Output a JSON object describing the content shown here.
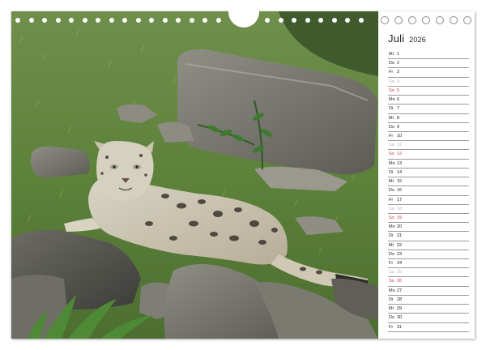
{
  "calendar": {
    "month": "Juli",
    "year": "2026",
    "days": [
      {
        "wd": "Mi",
        "d": "1",
        "kind": "weekday"
      },
      {
        "wd": "Do",
        "d": "2",
        "kind": "weekday"
      },
      {
        "wd": "Fr",
        "d": "3",
        "kind": "weekday"
      },
      {
        "wd": "Sa",
        "d": "4",
        "kind": "saturday"
      },
      {
        "wd": "So",
        "d": "5",
        "kind": "sunday"
      },
      {
        "wd": "Mo",
        "d": "6",
        "kind": "weekday"
      },
      {
        "wd": "Di",
        "d": "7",
        "kind": "weekday"
      },
      {
        "wd": "Mi",
        "d": "8",
        "kind": "weekday"
      },
      {
        "wd": "Do",
        "d": "9",
        "kind": "weekday"
      },
      {
        "wd": "Fr",
        "d": "10",
        "kind": "weekday"
      },
      {
        "wd": "Sa",
        "d": "11",
        "kind": "saturday"
      },
      {
        "wd": "So",
        "d": "12",
        "kind": "sunday"
      },
      {
        "wd": "Mo",
        "d": "13",
        "kind": "weekday"
      },
      {
        "wd": "Di",
        "d": "14",
        "kind": "weekday"
      },
      {
        "wd": "Mi",
        "d": "15",
        "kind": "weekday"
      },
      {
        "wd": "Do",
        "d": "16",
        "kind": "weekday"
      },
      {
        "wd": "Fr",
        "d": "17",
        "kind": "weekday"
      },
      {
        "wd": "Sa",
        "d": "18",
        "kind": "saturday"
      },
      {
        "wd": "So",
        "d": "19",
        "kind": "sunday"
      },
      {
        "wd": "Mo",
        "d": "20",
        "kind": "weekday"
      },
      {
        "wd": "Di",
        "d": "21",
        "kind": "weekday"
      },
      {
        "wd": "Mi",
        "d": "22",
        "kind": "weekday"
      },
      {
        "wd": "Do",
        "d": "23",
        "kind": "weekday"
      },
      {
        "wd": "Fr",
        "d": "24",
        "kind": "weekday"
      },
      {
        "wd": "Sa",
        "d": "25",
        "kind": "saturday"
      },
      {
        "wd": "So",
        "d": "26",
        "kind": "sunday"
      },
      {
        "wd": "Mo",
        "d": "27",
        "kind": "weekday"
      },
      {
        "wd": "Di",
        "d": "28",
        "kind": "weekday"
      },
      {
        "wd": "Mi",
        "d": "29",
        "kind": "weekday"
      },
      {
        "wd": "Do",
        "d": "30",
        "kind": "weekday"
      },
      {
        "wd": "Fr",
        "d": "31",
        "kind": "weekday"
      }
    ]
  },
  "colors": {
    "sunday": "#d23b3b",
    "saturday": "#b7b7b7",
    "text": "#222222",
    "grass": "#5b7a3e"
  },
  "photo": {
    "subject": "snow-leopard-among-rocks-and-grass"
  }
}
